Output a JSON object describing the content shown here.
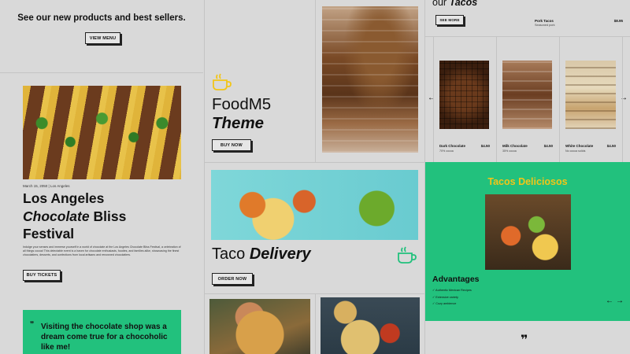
{
  "colors": {
    "accent_green": "#22c17d",
    "accent_yellow": "#f2c518",
    "background": "#d9d9d9"
  },
  "panel_a": {
    "headline": "See our new products and best sellers.",
    "view_button": "VIEW MENU"
  },
  "festival": {
    "date": "March 15, 2050 | Los Angeles",
    "title_line1": "Los Angeles",
    "title_em": "Chocolate",
    "title_bliss": " Bliss",
    "title_line3": "Festival",
    "body": "Indulge your senses and immerse yourself in a world of chocolate at the Los Angeles Chocolate Bliss Festival, a celebration of all things cocoa! This delectable event is a haven for chocolate enthusiasts, foodies, and families alike, showcasing the finest chocolatiers, desserts, and confections from local artisans and renowned chocolatiers.",
    "button": "BUY TICKETS"
  },
  "testimonial": {
    "quote": "Visiting the chocolate shop was a dream come true for a chocoholic like me!"
  },
  "foodm5": {
    "title": "FoodM5",
    "subtitle": "Theme",
    "button": "BUY NOW"
  },
  "taco_delivery": {
    "title": "Taco",
    "title_em": "Delivery",
    "button": "ORDER NOW"
  },
  "our_tacos": {
    "title_prefix": "our",
    "title_em": "Tacos",
    "button": "SEE MORE"
  },
  "menu_item": {
    "name": "Pork Tacos",
    "desc": "Seasoned pork",
    "price": "$8.95"
  },
  "products": [
    {
      "name": "Dark Chocolate",
      "desc": "70% cocoa",
      "price": "$4.50"
    },
    {
      "name": "Milk Chocolate",
      "desc": "35% cocoa",
      "price": "$4.50"
    },
    {
      "name": "White Chocolate",
      "desc": "No cocoa solids",
      "price": "$4.50"
    }
  ],
  "carousel": {
    "prev": "←",
    "next": "→"
  },
  "tacos_deliciosos": {
    "title": "Tacos Deliciosos",
    "advantages_title": "Advantages",
    "advantages": [
      "Authentic Mexican Recipes",
      "Extensive variety",
      "Cozy ambience"
    ],
    "prev": "←",
    "next": "→"
  },
  "quote_glyph": "❞"
}
